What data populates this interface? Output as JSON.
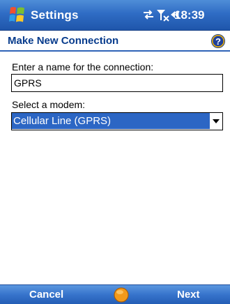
{
  "titlebar": {
    "app_title": "Settings",
    "icons": [
      "windows-start-icon",
      "connectivity-icon",
      "signal-off-icon",
      "volume-icon"
    ],
    "clock": "18:39"
  },
  "heading": {
    "title": "Make New Connection",
    "help_icon": "?"
  },
  "form": {
    "name_label": "Enter a name for the connection:",
    "name_value": "GPRS",
    "modem_label": "Select a modem:",
    "modem_value": "Cellular Line (GPRS)"
  },
  "softkeys": {
    "left": "Cancel",
    "right": "Next"
  },
  "colors": {
    "titlebar": "#2f6cc4",
    "heading_text": "#073b8c",
    "selection": "#2c66c4",
    "sip_button": "#f39a1b"
  }
}
